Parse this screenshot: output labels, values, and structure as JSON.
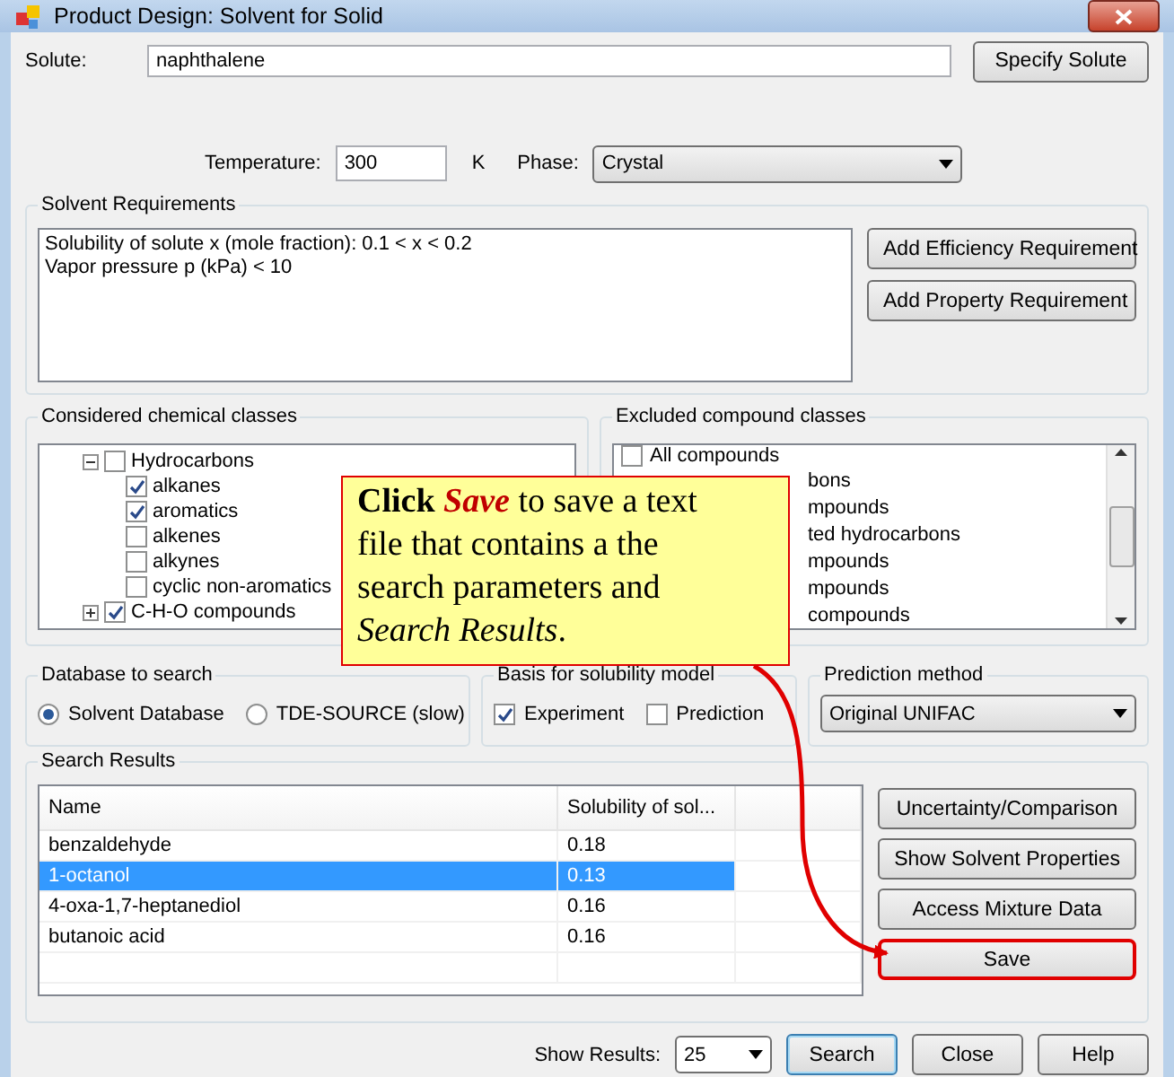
{
  "window": {
    "title": "Product Design: Solvent for Solid"
  },
  "solute": {
    "label": "Solute:",
    "value": "naphthalene",
    "button": "Specify Solute"
  },
  "conditions": {
    "temperature_label": "Temperature:",
    "temperature_value": "300",
    "temperature_unit": "K",
    "phase_label": "Phase:",
    "phase_value": "Crystal"
  },
  "solvent_requirements": {
    "title": "Solvent Requirements",
    "lines": [
      "Solubility of solute x (mole fraction): 0.1 < x < 0.2",
      "Vapor pressure p (kPa) < 10"
    ],
    "buttons": [
      "Add Efficiency Requirement",
      "Add Property Requirement"
    ]
  },
  "considered_classes": {
    "title": "Considered chemical classes",
    "items": [
      {
        "label": "Hydrocarbons",
        "checked": false,
        "expanded": true,
        "children": [
          {
            "label": "alkanes",
            "checked": true
          },
          {
            "label": "aromatics",
            "checked": true
          },
          {
            "label": "alkenes",
            "checked": false
          },
          {
            "label": "alkynes",
            "checked": false
          },
          {
            "label": "cyclic non-aromatics",
            "checked": false
          }
        ]
      },
      {
        "label": "C-H-O compounds",
        "checked": true,
        "expanded": false
      }
    ]
  },
  "excluded_classes": {
    "title": "Excluded compound classes",
    "items": [
      {
        "kind": "node",
        "label": "All compounds",
        "checked": false
      },
      {
        "kind": "fragment",
        "label": "bons"
      },
      {
        "kind": "fragment",
        "label": "mpounds"
      },
      {
        "kind": "fragment",
        "label": "ted hydrocarbons"
      },
      {
        "kind": "fragment",
        "label": "mpounds"
      },
      {
        "kind": "fragment",
        "label": "mpounds"
      },
      {
        "kind": "fragment",
        "label": "compounds"
      }
    ]
  },
  "database": {
    "title": "Database to search",
    "options": [
      {
        "label": "Solvent Database",
        "selected": true
      },
      {
        "label": "TDE-SOURCE (slow)",
        "selected": false
      }
    ]
  },
  "basis": {
    "title": "Basis for solubility model",
    "options": [
      {
        "label": "Experiment",
        "checked": true
      },
      {
        "label": "Prediction",
        "checked": false
      }
    ]
  },
  "prediction": {
    "title": "Prediction method",
    "value": "Original UNIFAC"
  },
  "search_results": {
    "title": "Search Results",
    "columns": [
      "Name",
      "Solubility of sol..."
    ],
    "rows": [
      {
        "cells": [
          "benzaldehyde",
          "0.18"
        ],
        "selected": false
      },
      {
        "cells": [
          "1-octanol",
          "0.13"
        ],
        "selected": true
      },
      {
        "cells": [
          "4-oxa-1,7-heptanediol",
          "0.16"
        ],
        "selected": false
      },
      {
        "cells": [
          "butanoic acid",
          "0.16"
        ],
        "selected": false
      }
    ],
    "buttons": [
      {
        "label": "Uncertainty/Comparison",
        "highlighted": false
      },
      {
        "label": "Show Solvent Properties",
        "highlighted": false
      },
      {
        "label": "Access Mixture Data",
        "highlighted": false
      },
      {
        "label": "Save",
        "highlighted": true
      }
    ]
  },
  "footer": {
    "show_results_label": "Show Results:",
    "show_results_value": "25",
    "buttons": [
      {
        "label": "Search",
        "focused": true
      },
      {
        "label": "Close",
        "focused": false
      },
      {
        "label": "Help",
        "focused": false
      }
    ]
  },
  "callout": {
    "segments": [
      {
        "text": "Click ",
        "kind": "bold"
      },
      {
        "text": "Save",
        "kind": "emphasis"
      },
      {
        "text": " to save a text file that contains a the search parameters and ",
        "kind": "plain"
      },
      {
        "text": "Search Results",
        "kind": "italic"
      },
      {
        "text": ".",
        "kind": "plain"
      }
    ]
  }
}
